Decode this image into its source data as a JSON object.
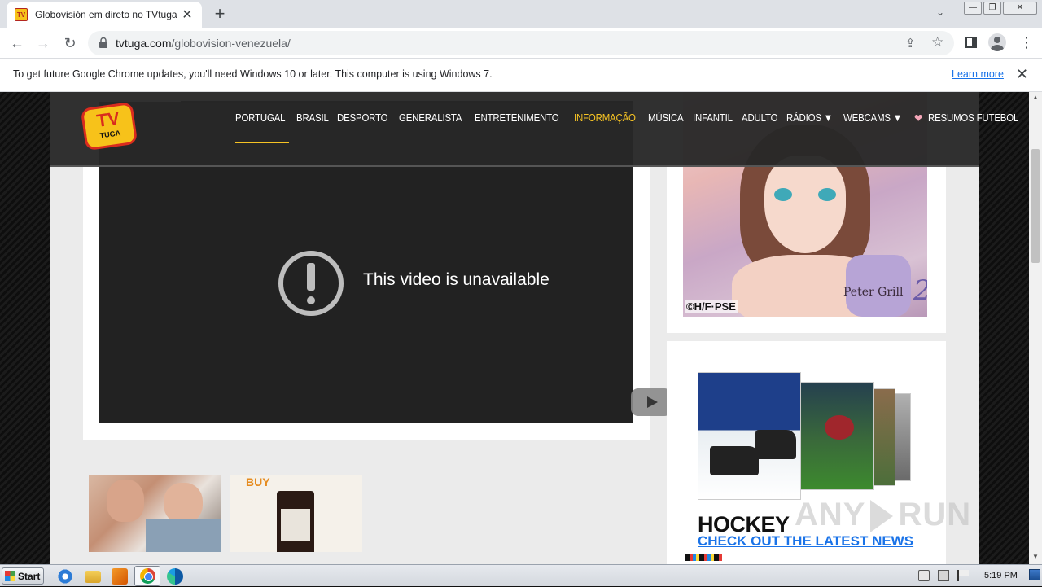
{
  "browser": {
    "tab": {
      "title": "Globovisión em direto no TVtuga",
      "favicon_text": "TV"
    },
    "url": {
      "host": "tvtuga.com",
      "path": "/globovision-venezuela/"
    },
    "icons": [
      "back-icon",
      "forward-icon",
      "reload-icon",
      "lock-icon",
      "share-icon",
      "star-icon",
      "side-panel-icon",
      "profile-icon",
      "menu-icon"
    ]
  },
  "infobar": {
    "text": "To get future Google Chrome updates, you'll need Windows 10 or later. This computer is using Windows 7.",
    "link": "Learn more"
  },
  "site": {
    "logo_top": "TV",
    "logo_bottom": "TUGA",
    "nav": [
      {
        "label": "PORTUGAL",
        "active": false
      },
      {
        "label": "BRASIL",
        "active": false
      },
      {
        "label": "DESPORTO",
        "active": false
      },
      {
        "label": "GENERALISTA",
        "active": false
      },
      {
        "label": "ENTRETENIMENTO",
        "active": false
      },
      {
        "label": "INFORMAÇÃO",
        "active": true
      },
      {
        "label": "MÚSICA",
        "active": false
      },
      {
        "label": "INFANTIL",
        "active": false
      },
      {
        "label": "ADULTO",
        "active": false
      },
      {
        "label": "RÁDIOS ▼",
        "active": false
      },
      {
        "label": "WEBCAMS ▼",
        "active": false
      },
      {
        "label": "RESUMOS FUTEBOL",
        "active": false
      }
    ],
    "accent_color": "#f6c324"
  },
  "video": {
    "message": "This video is unavailable"
  },
  "ads": {
    "thumb2_label": "BUY",
    "anime_copyright": "©H/F·PSE",
    "anime_brand": "Peter Grill",
    "anime_brand_num": "2",
    "hockey_title": "HOCKEY",
    "hockey_link": "CHECK OUT THE LATEST NEWS"
  },
  "watermark": {
    "left": "ANY",
    "right": "RUN"
  },
  "taskbar": {
    "start_label": "Start",
    "clock": "5:19 PM",
    "pinned": [
      "internet-explorer-icon",
      "file-explorer-icon",
      "media-player-icon",
      "chrome-icon",
      "edge-icon"
    ]
  }
}
